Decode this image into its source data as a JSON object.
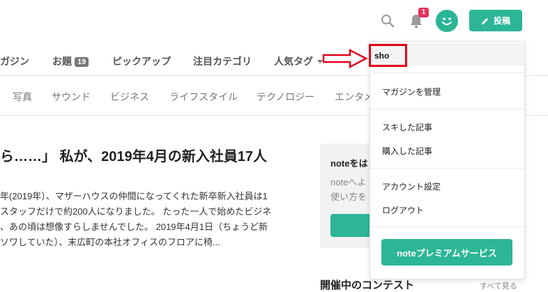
{
  "header": {
    "notification_count": "1",
    "post_label": "投稿",
    "accent": "#2cb696",
    "badge_color": "#e3335b"
  },
  "nav_main": [
    {
      "label": "ガジン"
    },
    {
      "label": "お題",
      "badge": "19"
    },
    {
      "label": "ピックアップ"
    },
    {
      "label": "注目カテゴリ"
    },
    {
      "label": "人気タグ"
    }
  ],
  "nav_categories": [
    "写真",
    "サウンド",
    "ビジネス",
    "ライフスタイル",
    "テクノロジー",
    "エンタメ"
  ],
  "article": {
    "title": "ら……」 私が、2019年4月の新入社員17人",
    "body": [
      "年(2019年）、マザーハウスの仲間になってくれた新卒新入社員は1",
      "スタッフだけで約200人になりました。 たった一人で始めたビジネ",
      "、あの頃は想像すらしませんでした。 2019年4月1日（ちょうど新",
      "ソワしていた）、末広町の本社オフィスのフロアに椅..."
    ]
  },
  "side_card": {
    "title": "noteをは",
    "text_lines": [
      "noteへよ",
      "使い方を"
    ]
  },
  "contest": {
    "title": "開催中のコンテスト",
    "see_all": "すべて見る"
  },
  "dropdown": {
    "username": "sho",
    "items": [
      "マガジンを管理",
      "スキした記事",
      "購入した記事",
      "アカウント設定",
      "ログアウト"
    ],
    "premium_label": "noteプレミアムサービス"
  },
  "annotation": {
    "color": "#e0001b"
  }
}
